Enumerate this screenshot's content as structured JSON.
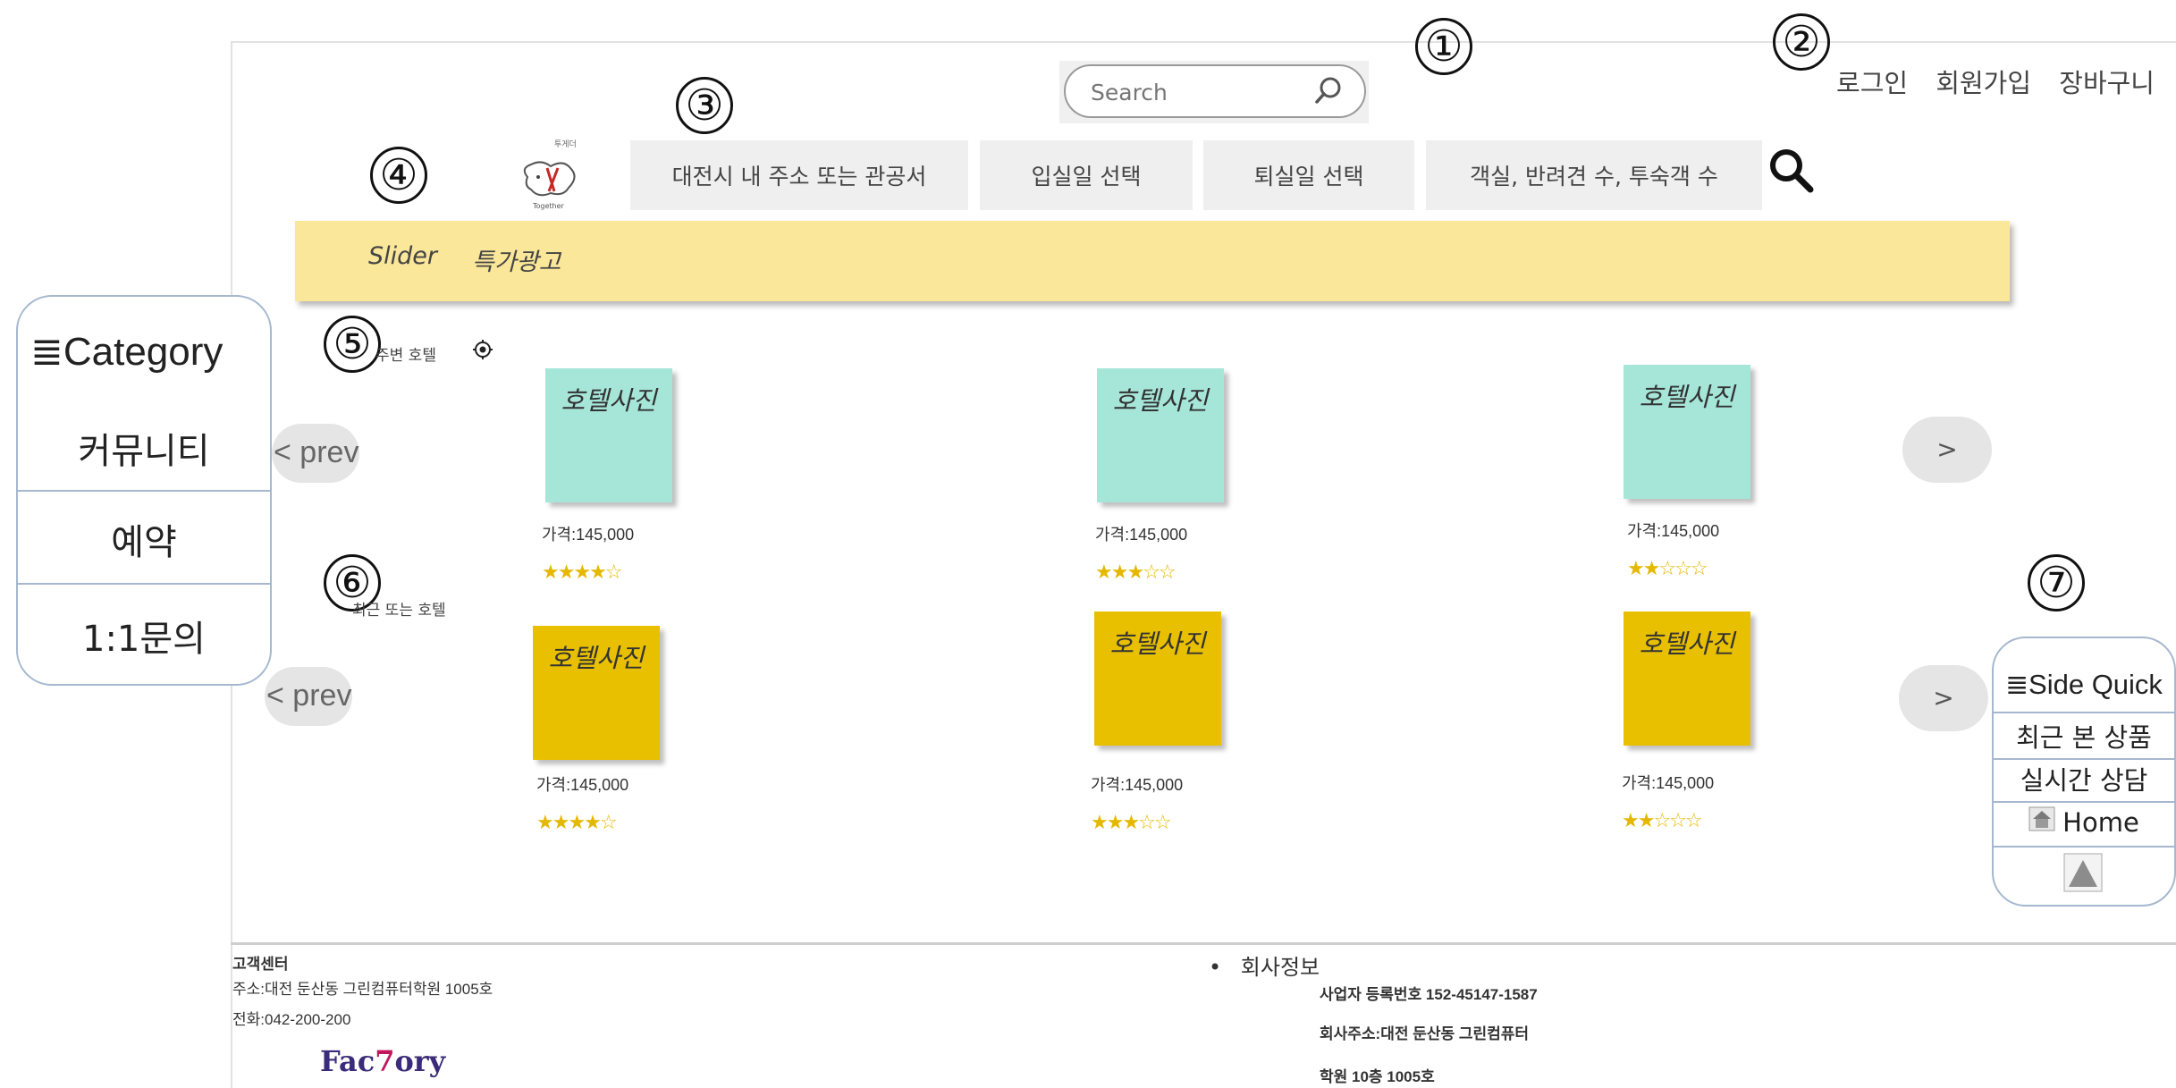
{
  "markers": [
    "①",
    "②",
    "③",
    "④",
    "⑤",
    "⑥",
    "⑦"
  ],
  "search": {
    "placeholder": "Search"
  },
  "top_links": {
    "login": "로그인",
    "signup": "회원가입",
    "cart": "장바구니"
  },
  "logo": {
    "text_top": "투게더",
    "text_bottom": "Together"
  },
  "filters": {
    "location": "대전시 내 주소 또는 관공서",
    "checkin": "입실일 선택",
    "checkout": "퇴실일 선택",
    "guests": "객실, 반려견 수, 투숙객 수"
  },
  "banner": {
    "slider": "Slider",
    "ad": "특가광고"
  },
  "category": {
    "title": "≣Category",
    "items": [
      "커뮤니티",
      "예약",
      "1:1문의"
    ]
  },
  "sections": {
    "nearby": "주변 호텔",
    "recent": "최근 또는 호텔",
    "prev_label": "< prev",
    "next_label": ">"
  },
  "nearby_hotels": [
    {
      "photo": "호텔사진",
      "price": "가격:145,000",
      "stars": "★★★★☆",
      "rating": 4
    },
    {
      "photo": "호텔사진",
      "price": "가격:145,000",
      "stars": "★★★☆☆",
      "rating": 3
    },
    {
      "photo": "호텔사진",
      "price": "가격:145,000",
      "stars": "★★☆☆☆",
      "rating": 2
    }
  ],
  "recent_hotels": [
    {
      "photo": "호텔사진",
      "price": "가격:145,000",
      "stars": "★★★★☆",
      "rating": 4
    },
    {
      "photo": "호텔사진",
      "price": "가격:145,000",
      "stars": "★★★☆☆",
      "rating": 3
    },
    {
      "photo": "호텔사진",
      "price": "가격:145,000",
      "stars": "★★☆☆☆",
      "rating": 2
    }
  ],
  "side_quick": {
    "title": "≣Side Quick",
    "recent": "최근 본 상품",
    "chat": "실시간 상담",
    "home": "Home"
  },
  "footer": {
    "cs_title": "고객센터",
    "address": "주소:대전 둔산동 그린컴퓨터학원 1005호",
    "phone": "전화:042-200-200",
    "brand_a": "Fac",
    "brand_b": "7",
    "brand_c": "ory",
    "company_title": "회사정보",
    "biz_no": "사업자 등록번호 152-45147-1587",
    "company_address_1": "회사주소:대전 둔산동 그린컴퓨터",
    "company_address_2": "학원 10층 1005호"
  },
  "colors": {
    "banner": "#fbe79a",
    "teal_card": "#a6e6d9",
    "gold_card": "#e9c000",
    "star": "#e5b800",
    "panel_border": "#a6b8cf"
  }
}
